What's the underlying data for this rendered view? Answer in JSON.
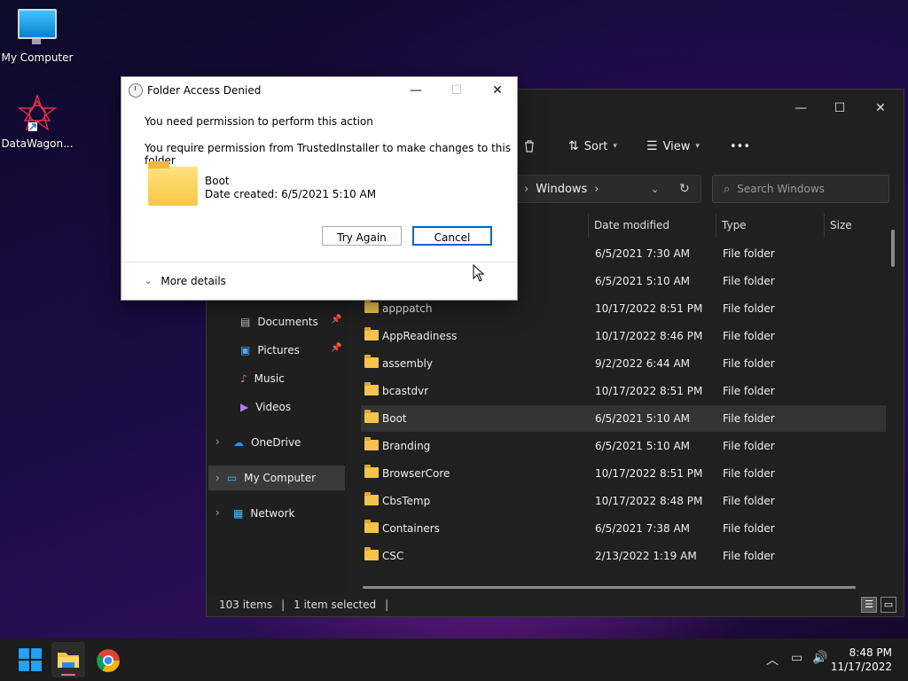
{
  "desktop": {
    "icons": [
      {
        "label": "My Computer"
      },
      {
        "label": "DataWagon..."
      }
    ]
  },
  "explorer": {
    "toolbar": {
      "sort": "Sort",
      "view": "View",
      "more": "•••"
    },
    "address": {
      "prefix": ")",
      "current": "Windows"
    },
    "search_placeholder": "Search Windows",
    "nav": [
      {
        "label": "Documents",
        "pinned": true
      },
      {
        "label": "Pictures",
        "pinned": true
      },
      {
        "label": "Music",
        "pinned": false
      },
      {
        "label": "Videos",
        "pinned": false
      },
      {
        "label": "OneDrive"
      },
      {
        "label": "My Computer"
      },
      {
        "label": "Network"
      }
    ],
    "columns": {
      "date": "Date modified",
      "type": "Type",
      "size": "Size"
    },
    "rows": [
      {
        "name": "",
        "date": "6/5/2021 7:30 AM",
        "type": "File folder"
      },
      {
        "name": "",
        "date": "6/5/2021 5:10 AM",
        "type": "File folder"
      },
      {
        "name": "apppatch",
        "date": "10/17/2022 8:51 PM",
        "type": "File folder"
      },
      {
        "name": "AppReadiness",
        "date": "10/17/2022 8:46 PM",
        "type": "File folder"
      },
      {
        "name": "assembly",
        "date": "9/2/2022 6:44 AM",
        "type": "File folder"
      },
      {
        "name": "bcastdvr",
        "date": "10/17/2022 8:51 PM",
        "type": "File folder"
      },
      {
        "name": "Boot",
        "date": "6/5/2021 5:10 AM",
        "type": "File folder"
      },
      {
        "name": "Branding",
        "date": "6/5/2021 5:10 AM",
        "type": "File folder"
      },
      {
        "name": "BrowserCore",
        "date": "10/17/2022 8:51 PM",
        "type": "File folder"
      },
      {
        "name": "CbsTemp",
        "date": "10/17/2022 8:48 PM",
        "type": "File folder"
      },
      {
        "name": "Containers",
        "date": "6/5/2021 7:38 AM",
        "type": "File folder"
      },
      {
        "name": "CSC",
        "date": "2/13/2022 1:19 AM",
        "type": "File folder"
      }
    ],
    "status": {
      "items": "103 items",
      "selected": "1 item selected"
    }
  },
  "dialog": {
    "title": "Folder Access Denied",
    "line1": "You need permission to perform this action",
    "line2": "You require permission from TrustedInstaller to make changes to this folder",
    "folder_name": "Boot",
    "date_created": "Date created: 6/5/2021 5:10 AM",
    "try_again": "Try Again",
    "cancel": "Cancel",
    "more_details": "More details"
  },
  "taskbar": {
    "time": "8:48 PM",
    "date": "11/17/2022"
  },
  "colors": {
    "accent": "#0067c0",
    "folder": "#f2c34d",
    "taskbar": "#1c1c1c"
  }
}
